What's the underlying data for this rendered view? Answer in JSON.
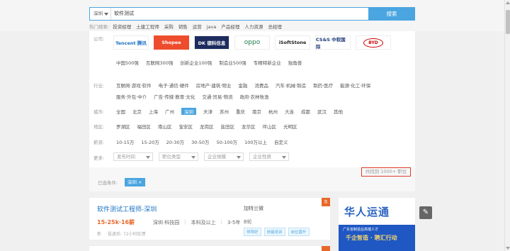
{
  "search": {
    "city": "深圳",
    "keyword": "软件测试",
    "button_label": "搜索"
  },
  "hot": {
    "label": "热门搜索:",
    "terms": [
      "投资经理",
      "土建工程师",
      "采购",
      "销售",
      "运营",
      "java",
      "产品经理",
      "人力资源",
      "总经理"
    ]
  },
  "company_row": {
    "label": "公司:",
    "logos": [
      "Tencent 腾讯",
      "Shopee",
      "DK 德科信息",
      "oppo",
      "iSoftStone",
      "CS&S 中软国际",
      "BYD"
    ],
    "categories": [
      "中国500强",
      "互联网300强",
      "创新企业100强",
      "制造业500强",
      "专精特新企业",
      "独角兽"
    ]
  },
  "industry": {
    "label": "行业:",
    "row1": [
      "互联网·游戏·软件",
      "电子·通信·硬件",
      "房地产·建筑·物业",
      "金融",
      "消费品",
      "汽车·机械·制造",
      "制药·医疗",
      "能源·化工·环保"
    ],
    "row2": [
      "服务·外包·中介",
      "广告·传媒·教育·文化",
      "交通·贸易·物流",
      "政府·农林牧渔"
    ]
  },
  "city": {
    "label": "城市:",
    "options": [
      "全国",
      "北京",
      "上海",
      "广州",
      "深圳",
      "天津",
      "苏州",
      "重庆",
      "南京",
      "杭州",
      "大连",
      "成都",
      "武汉",
      "其他"
    ],
    "active": "深圳"
  },
  "district": {
    "label": "地区:",
    "options": [
      "罗湖区",
      "福田区",
      "南山区",
      "宝安区",
      "龙岗区",
      "盐田区",
      "龙华区",
      "坪山区",
      "光明区"
    ]
  },
  "salary": {
    "label": "薪资:",
    "options": [
      "10-15万",
      "15-20万",
      "20-30万",
      "30-50万",
      "50-100万",
      "100万以上",
      "自定义"
    ]
  },
  "more": {
    "label": "更多:",
    "dropdowns": [
      "发布时间",
      "职位类型",
      "企业规模",
      "企业性质"
    ]
  },
  "selected": {
    "label": "已选条件:",
    "tag": "深圳 ×",
    "count_text": "共找到 1000+ 职位"
  },
  "job": {
    "title": "软件测试工程师-深圳",
    "salary": "15-25k·16薪",
    "location": "深圳·科技园",
    "education": "本科及以上",
    "experience": "3-5年",
    "tag": "新",
    "meta_extra": "投递后: 72小时反馈",
    "company": "加特兰微",
    "company_type": "B轮",
    "perks": [
      "领导好",
      "技能培训",
      "岗位晋升"
    ],
    "corner": "急"
  },
  "ad": {
    "title": "华人运通",
    "line1": "广东省制造业高端人才",
    "line2": "千企智造 · 聘汇行动"
  },
  "colors": {
    "accent": "#4aa5e0",
    "salary": "#e8682a",
    "count_box_border": "#e03b2b"
  }
}
